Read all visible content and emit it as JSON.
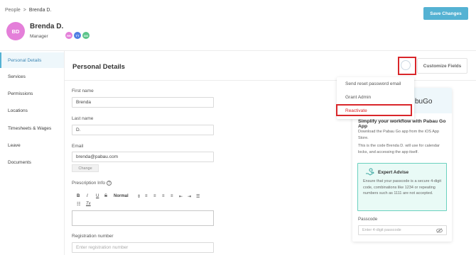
{
  "breadcrumb": {
    "root": "People",
    "sep": ">",
    "current": "Brenda D."
  },
  "user": {
    "initials": "BD",
    "name": "Brenda D.",
    "role": "Manager"
  },
  "badges": [
    {
      "label": "RR",
      "color": "#e47fd9"
    },
    {
      "label": "TT",
      "color": "#4f7ee3"
    },
    {
      "label": "GG",
      "color": "#5cc48a"
    }
  ],
  "header": {
    "save_label": "Save Changes"
  },
  "sidebar": {
    "items": [
      {
        "label": "Personal Details",
        "active": true
      },
      {
        "label": "Services"
      },
      {
        "label": "Permissions"
      },
      {
        "label": "Locations"
      },
      {
        "label": "Timesheets & Wages"
      },
      {
        "label": "Leave"
      },
      {
        "label": "Documents"
      }
    ]
  },
  "main": {
    "title": "Personal Details",
    "customize_label": "Customize Fields",
    "fields": {
      "first_name_label": "First name",
      "first_name_value": "Brenda",
      "last_name_label": "Last name",
      "last_name_value": "D.",
      "email_label": "Email",
      "email_value": "brenda@pabau.com",
      "change_label": "Change",
      "prescription_label": "Prescription Info",
      "registration_label": "Registration number",
      "registration_placeholder": "Enter registration number"
    },
    "toolbar": {
      "bold": "B",
      "italic": "I",
      "underline": "U",
      "link": "S",
      "format": "Normal",
      "spin": "⇕",
      "clear": "Tx"
    }
  },
  "menu": {
    "items": [
      "Send reset password email",
      "Grant Admin",
      "Reactivate"
    ]
  },
  "promo": {
    "brand": "Go",
    "brand_prefix": "bu",
    "heading": "Simplify your workflow with Pabau Go App",
    "p1": "Download the Pabau Go app from the iOS App Store.",
    "p2": "This is the code Brenda D. will use for calendar locks, and accessing the app itself.",
    "advise_title": "Expert Advise",
    "advise_text": "Ensure that your passcode is a secure 4-digit code, combinations like 1234 or repeating numbers such as 1111 are not accepted.",
    "passcode_label": "Passcode",
    "passcode_placeholder": "Enter 4-digit passcode"
  },
  "colors": {
    "accent": "#54b2d3",
    "danger": "#d9262a",
    "avatar": "#e47fd9",
    "advise_border": "#6ad1bf"
  }
}
